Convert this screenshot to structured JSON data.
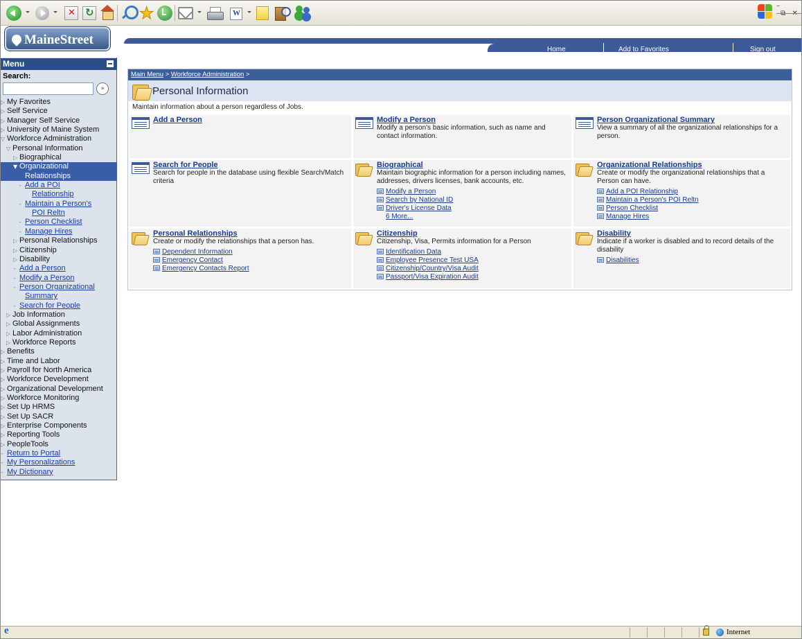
{
  "browser": {
    "status_zone": "Internet"
  },
  "brand": {
    "logo_text": "MaineStreet"
  },
  "header": {
    "links": [
      "Home",
      "Add to Favorites",
      "Sign out"
    ]
  },
  "sidebar": {
    "title": "Menu",
    "search_label": "Search:",
    "search_value": "",
    "items": [
      {
        "label": "My Favorites",
        "level": 0,
        "kind": "closed"
      },
      {
        "label": "Self Service",
        "level": 0,
        "kind": "closed"
      },
      {
        "label": "Manager Self Service",
        "level": 0,
        "kind": "closed"
      },
      {
        "label": "University of Maine System",
        "level": 0,
        "kind": "closed"
      },
      {
        "label": "Workforce Administration",
        "level": 0,
        "kind": "open"
      },
      {
        "label": "Personal Information",
        "level": 1,
        "kind": "open"
      },
      {
        "label": "Biographical",
        "level": 2,
        "kind": "closed"
      },
      {
        "label": "Organizational",
        "level": 2,
        "kind": "selected"
      },
      {
        "label": "Relationships",
        "level": 3,
        "kind": "selected-cont"
      },
      {
        "label": "Add a POI",
        "level": 3,
        "kind": "link"
      },
      {
        "label": "Relationship",
        "level": 4,
        "kind": "link-cont"
      },
      {
        "label": "Maintain a Person's",
        "level": 3,
        "kind": "link"
      },
      {
        "label": "POI Reltn",
        "level": 4,
        "kind": "link-cont"
      },
      {
        "label": "Person Checklist",
        "level": 3,
        "kind": "link"
      },
      {
        "label": "Manage Hires",
        "level": 3,
        "kind": "link"
      },
      {
        "label": "Personal Relationships",
        "level": 2,
        "kind": "closed"
      },
      {
        "label": "Citizenship",
        "level": 2,
        "kind": "closed"
      },
      {
        "label": "Disability",
        "level": 2,
        "kind": "closed"
      },
      {
        "label": "Add a Person",
        "level": 2,
        "kind": "link"
      },
      {
        "label": "Modify a Person",
        "level": 2,
        "kind": "link"
      },
      {
        "label": "Person Organizational",
        "level": 2,
        "kind": "link"
      },
      {
        "label": "Summary",
        "level": 3,
        "kind": "link-cont"
      },
      {
        "label": "Search for People",
        "level": 2,
        "kind": "link"
      },
      {
        "label": "Job Information",
        "level": 1,
        "kind": "closed"
      },
      {
        "label": "Global Assignments",
        "level": 1,
        "kind": "closed"
      },
      {
        "label": "Labor Administration",
        "level": 1,
        "kind": "closed"
      },
      {
        "label": "Workforce Reports",
        "level": 1,
        "kind": "closed"
      },
      {
        "label": "Benefits",
        "level": 0,
        "kind": "closed"
      },
      {
        "label": "Time and Labor",
        "level": 0,
        "kind": "closed"
      },
      {
        "label": "Payroll for North America",
        "level": 0,
        "kind": "closed"
      },
      {
        "label": "Workforce Development",
        "level": 0,
        "kind": "closed"
      },
      {
        "label": "Organizational Development",
        "level": 0,
        "kind": "closed"
      },
      {
        "label": "Workforce Monitoring",
        "level": 0,
        "kind": "closed"
      },
      {
        "label": "Set Up HRMS",
        "level": 0,
        "kind": "closed"
      },
      {
        "label": "Set Up SACR",
        "level": 0,
        "kind": "closed"
      },
      {
        "label": "Enterprise Components",
        "level": 0,
        "kind": "closed"
      },
      {
        "label": "Reporting Tools",
        "level": 0,
        "kind": "closed"
      },
      {
        "label": "PeopleTools",
        "level": 0,
        "kind": "closed"
      },
      {
        "label": "Return to Portal",
        "level": 0,
        "kind": "link"
      },
      {
        "label": "My Personalizations",
        "level": 0,
        "kind": "link"
      },
      {
        "label": "My Dictionary",
        "level": 0,
        "kind": "link"
      }
    ]
  },
  "page": {
    "breadcrumb": [
      "Main Menu",
      "Workforce Administration"
    ],
    "breadcrumb_sep": ">",
    "title": "Personal Information",
    "description": "Maintain information about a person regardless of Jobs."
  },
  "cells": [
    {
      "title": "Add a Person",
      "icon": "component",
      "desc": "",
      "links": []
    },
    {
      "title": "Modify a Person",
      "icon": "component",
      "desc": "Modify a person's basic information, such as name and contact information.",
      "links": []
    },
    {
      "title": "Person Organizational Summary",
      "icon": "component",
      "desc": "View a summary of all the organizational relationships for a person.",
      "links": []
    },
    {
      "title": "Search for People",
      "icon": "component",
      "desc": "Search for people in the database using flexible Search/Match criteria",
      "links": []
    },
    {
      "title": "Biographical",
      "icon": "folder",
      "desc": "Maintain biographic information for a person including names, addresses, drivers licenses, bank accounts, etc.",
      "links": [
        "Modify a Person",
        "Search by National ID",
        "Driver's License Data"
      ],
      "more": "6 More..."
    },
    {
      "title": "Organizational Relationships",
      "icon": "folder",
      "desc": "Create or modify the organizational relationships that a Person can have.",
      "links": [
        "Add a POI Relationship",
        "Maintain a Person's POI Reltn",
        "Person Checklist",
        "Manage Hires"
      ]
    },
    {
      "title": "Personal Relationships",
      "icon": "folder",
      "desc": "Create or modify the relationships that a person has.",
      "links": [
        "Dependent Information",
        "Emergency Contact",
        "Emergency Contacts Report"
      ]
    },
    {
      "title": "Citizenship",
      "icon": "folder",
      "desc": "Citizenship, Visa, Permits information for a Person",
      "links": [
        "Identification Data",
        "Employee Presence Test USA",
        "Citizenship/Country/Visa Audit",
        "Passport/Visa Expiration Audit"
      ]
    },
    {
      "title": "Disability",
      "icon": "folder",
      "desc": "Indicate if a worker is disabled and to record details of the disability",
      "links": [
        "Disabilities"
      ]
    }
  ]
}
